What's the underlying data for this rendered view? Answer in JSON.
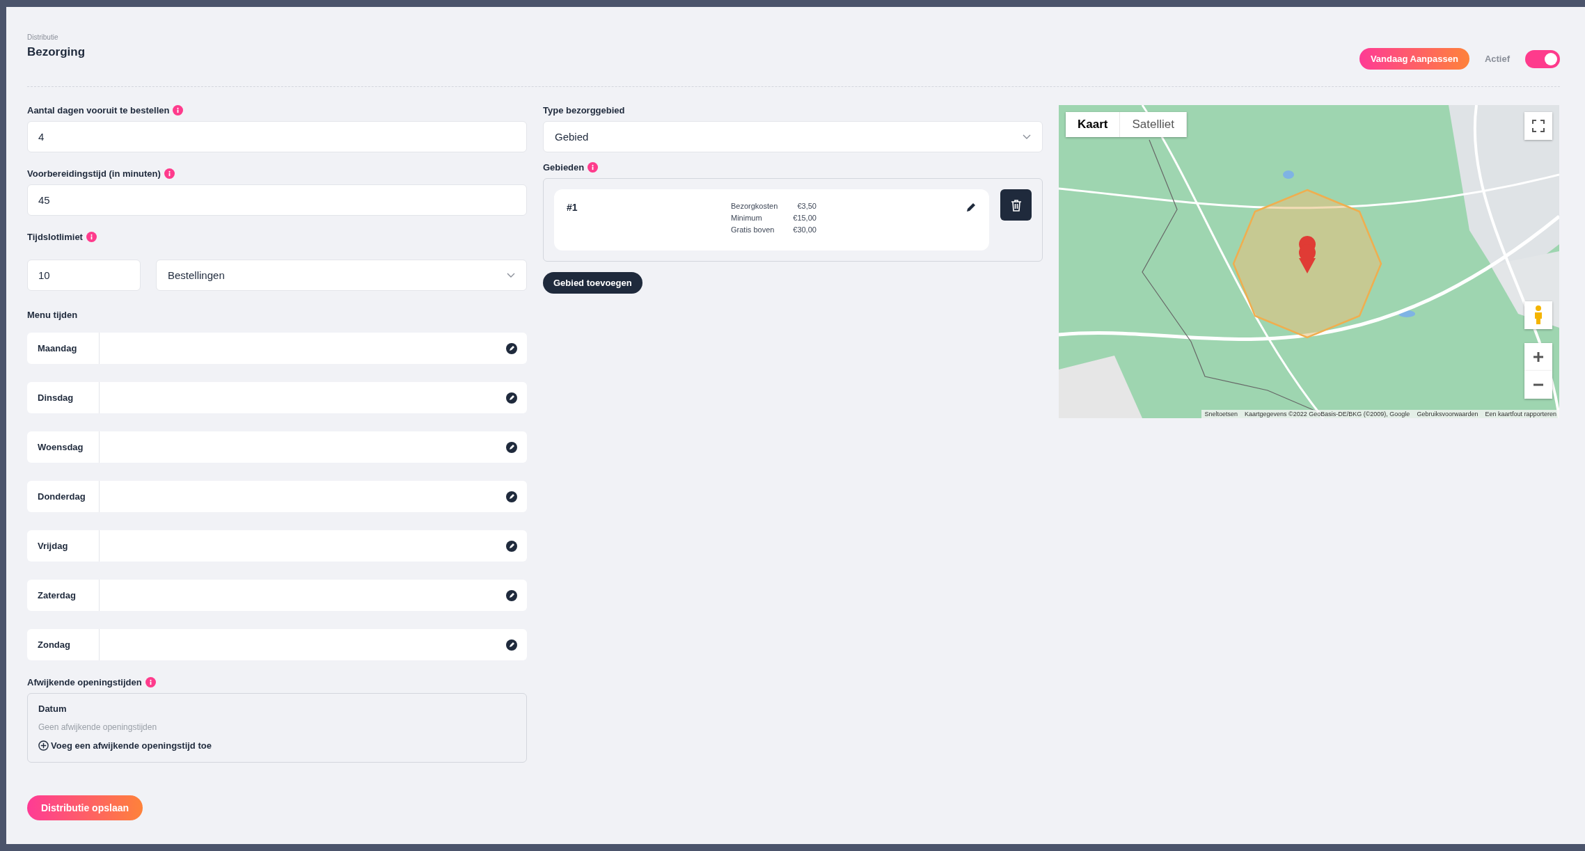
{
  "header": {
    "breadcrumb": "Distributie",
    "title": "Bezorging",
    "today_button": "Vandaag Aanpassen",
    "active_label": "Actief",
    "active_on": true
  },
  "fields": [
    {
      "label": "Aantal dagen vooruit te bestellen",
      "info": true,
      "value": "4"
    },
    {
      "label": "Voorbereidingstijd (in minuten)",
      "info": true,
      "value": "45"
    }
  ],
  "timeslot": {
    "label": "Tijdslotlimiet",
    "info": true,
    "value": "10",
    "unit": "Bestellingen"
  },
  "menu_times": {
    "label": "Menu tijden",
    "days": [
      "Maandag",
      "Dinsdag",
      "Woensdag",
      "Donderdag",
      "Vrijdag",
      "Zaterdag",
      "Zondag"
    ]
  },
  "exceptions": {
    "label": "Afwijkende openingstijden",
    "info": true,
    "column": "Datum",
    "empty": "Geen afwijkende openingstijden",
    "add": "Voeg een afwijkende openingstijd toe"
  },
  "save_button": "Distributie opslaan",
  "area_type": {
    "label": "Type bezorggebied",
    "value": "Gebied"
  },
  "areas": {
    "label": "Gebieden",
    "info": true,
    "items": [
      {
        "name": "#1",
        "rows": [
          {
            "label": "Bezorgkosten",
            "value": "€3,50"
          },
          {
            "label": "Minimum",
            "value": "€15,00"
          },
          {
            "label": "Gratis boven",
            "value": "€30,00"
          }
        ]
      }
    ],
    "add_button": "Gebied toevoegen"
  },
  "map": {
    "kind": "picture",
    "tabs": [
      {
        "label": "Kaart",
        "selected": true
      },
      {
        "label": "Satelliet",
        "selected": false
      }
    ],
    "attribution": [
      "Sneltoetsen",
      "Kaartgegevens ©2022 GeoBasis-DE/BKG (©2009), Google",
      "Gebruiksvoorwaarden",
      "Een kaartfout rapporteren"
    ]
  }
}
